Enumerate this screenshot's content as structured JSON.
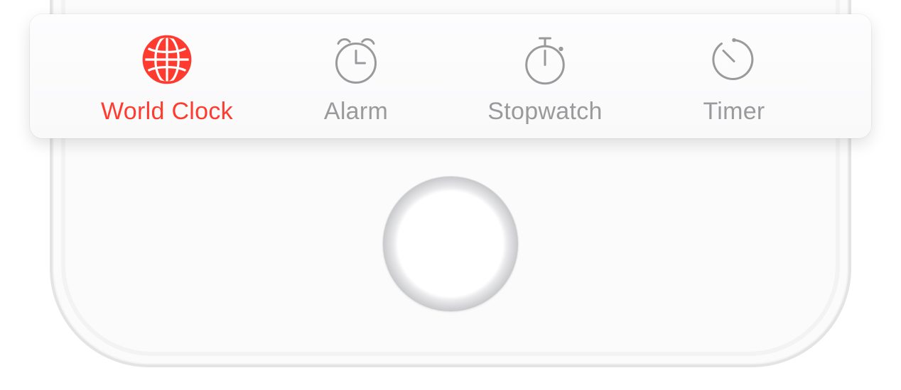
{
  "colors": {
    "accent": "#ff3b30",
    "inactive": "#9a9a9d",
    "card_bg": "#fafafb"
  },
  "tabbar": {
    "active_index": 0,
    "items": [
      {
        "label": "World Clock",
        "icon": "globe-icon",
        "active": true
      },
      {
        "label": "Alarm",
        "icon": "alarm-icon",
        "active": false
      },
      {
        "label": "Stopwatch",
        "icon": "stopwatch-icon",
        "active": false
      },
      {
        "label": "Timer",
        "icon": "timer-icon",
        "active": false
      }
    ]
  }
}
